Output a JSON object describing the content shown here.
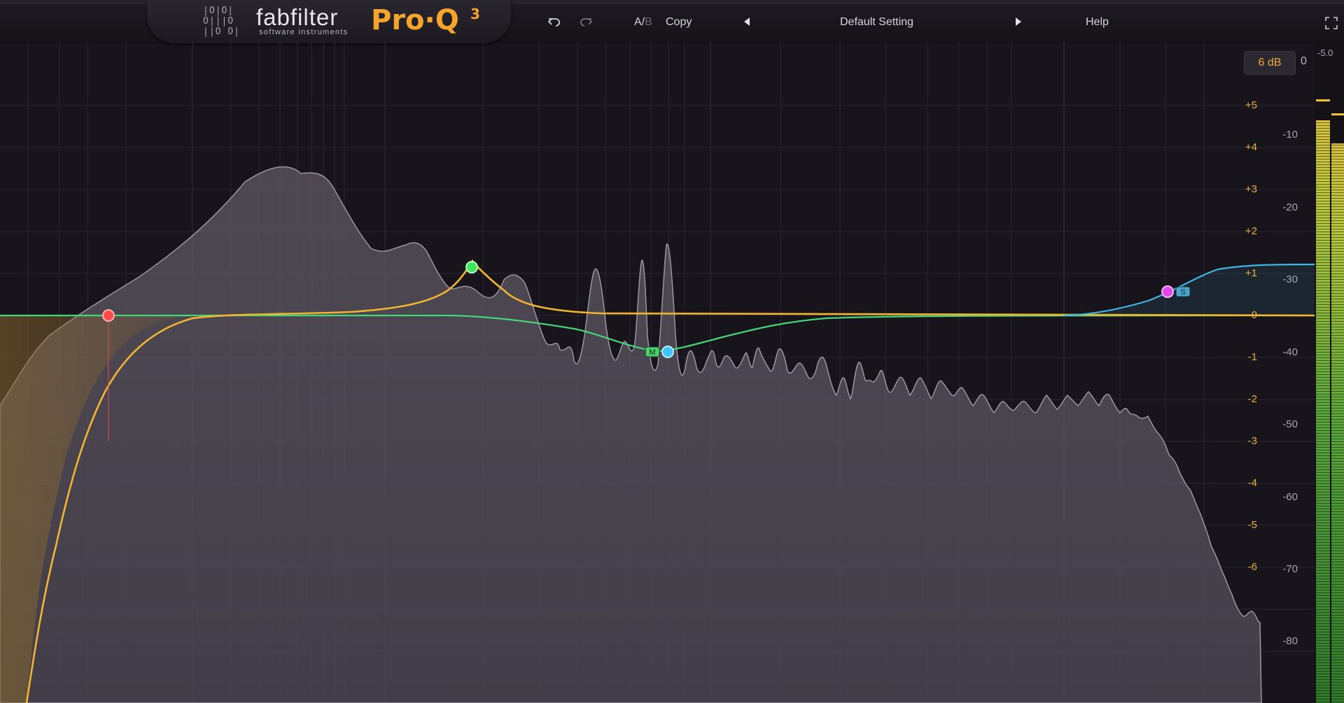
{
  "header": {
    "bitgrid": [
      "|O|O|",
      "O|||O",
      "||O O|"
    ],
    "brand": "fabfilter",
    "brand_sub": "software instruments",
    "product": "Pro·Q",
    "product_version": "3",
    "undo_icon": "undo-icon",
    "redo_icon": "redo-icon",
    "ab_a": "A/",
    "ab_b": "B",
    "copy_label": "Copy",
    "prev_preset_icon": "triangle-left-icon",
    "preset_name": "Default Setting",
    "next_preset_icon": "triangle-right-icon",
    "help_label": "Help",
    "fullscreen_icon": "fullscreen-icon"
  },
  "display_range": {
    "range_value": "6 dB",
    "zero_label": "0"
  },
  "gain_scale": [
    "+5",
    "+4",
    "+3",
    "+2",
    "+1",
    "0",
    "-1",
    "-2",
    "-3",
    "-4",
    "-5",
    "-6"
  ],
  "analyzer_scale": [
    "-10",
    "-20",
    "-30",
    "-40",
    "-50",
    "-60",
    "-70",
    "-80"
  ],
  "meter": {
    "peak_label": "-5.0"
  },
  "bands": [
    {
      "name": "band-1",
      "type": "low-cut",
      "color": "#ff4a4a"
    },
    {
      "name": "band-2",
      "type": "bell-boost",
      "color": "#3ee45a"
    },
    {
      "name": "band-3",
      "type": "bell-cut-mid",
      "color": "#3ec4ff",
      "badge": "M"
    },
    {
      "name": "band-4",
      "type": "high-shelf-side",
      "color": "#e048e8",
      "badge": "S"
    }
  ],
  "colors": {
    "accent": "#f4a52a",
    "background": "#17141b",
    "eq_curve": "#f2b531",
    "mid_curve": "#45d67a",
    "side_curve": "#3fb6e6"
  }
}
